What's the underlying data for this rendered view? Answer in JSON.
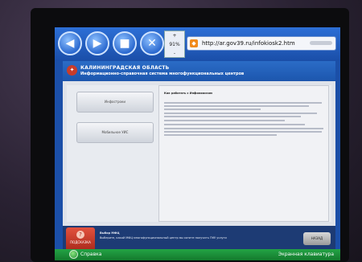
{
  "browser": {
    "zoom_label": "91%",
    "zoom_plus": "+",
    "zoom_minus": "-",
    "url": "http://ar.gov39.ru/infokiosk2.htm"
  },
  "header": {
    "region": "КАЛИНИНГРАДСКАЯ ОБЛАСТЬ",
    "system": "Информационно-справочная система многофункциональных центров"
  },
  "menu": [
    {
      "label": "Инфостроки"
    },
    {
      "label": "Мобильное УИС"
    }
  ],
  "info": {
    "title": "Как работать с Инфокиоском"
  },
  "footer": {
    "help_label": "ПОДСКАЗКА",
    "tip_title": "Выбор МФЦ",
    "tip_text": "Выберите, какой МФЦ многофункциональный центр вы хотите получить ГМУ услуги",
    "back_label": "НАЗАД"
  },
  "status": {
    "left": "Справка",
    "right": "Экранная клавиатура"
  }
}
